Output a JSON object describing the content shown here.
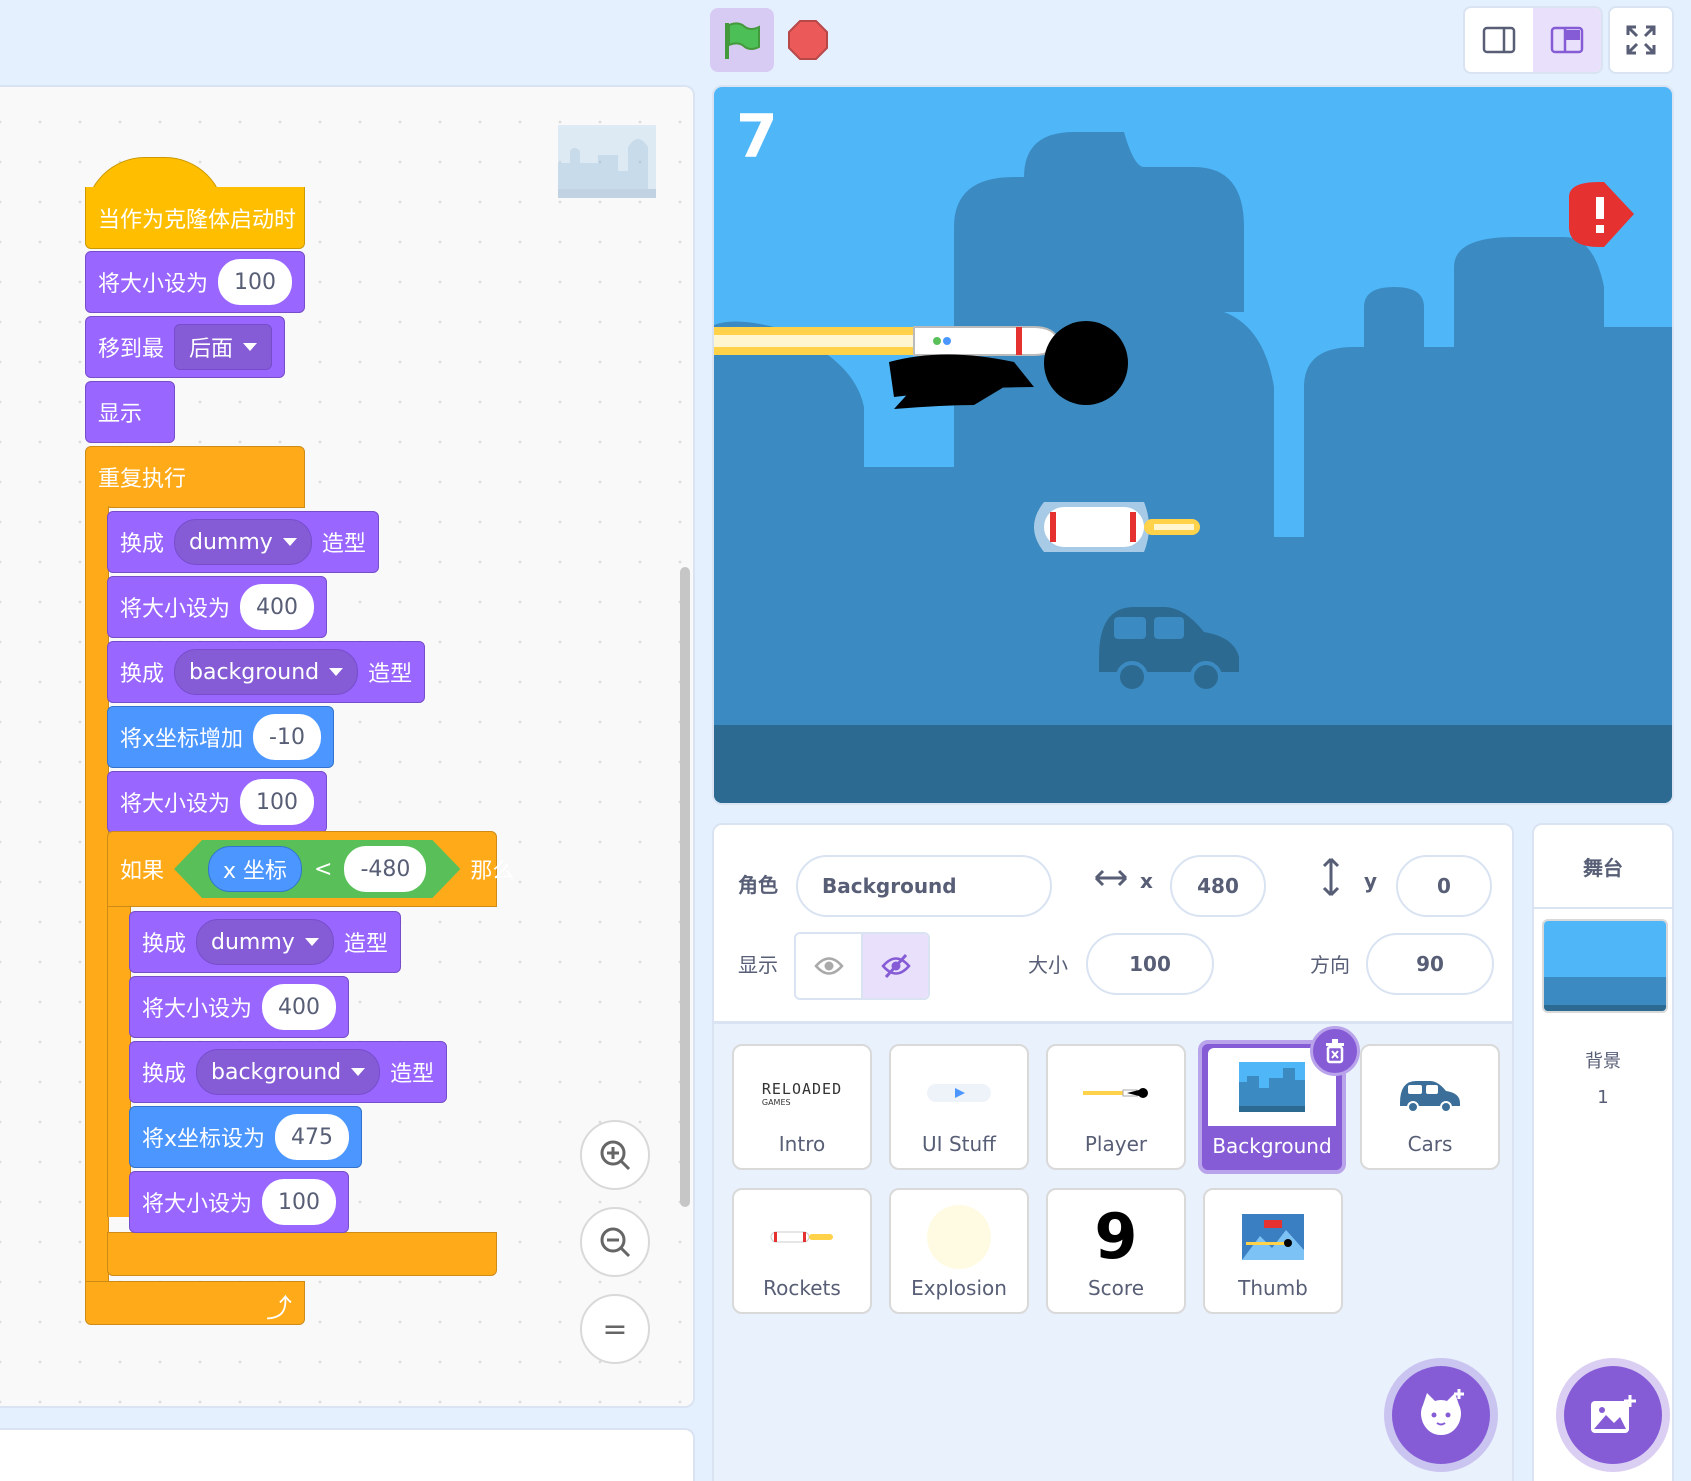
{
  "code_blocks": {
    "hat": "当作为克隆体启动时",
    "set_size_1": {
      "label": "将大小设为",
      "value": "100"
    },
    "go_to_layer": {
      "label": "移到最",
      "option": "后面"
    },
    "show": "显示",
    "forever": "重复执行",
    "switch_1": {
      "label": "换成",
      "option": "dummy",
      "suffix": "造型"
    },
    "set_size_2": {
      "label": "将大小设为",
      "value": "400"
    },
    "switch_2": {
      "label": "换成",
      "option": "background",
      "suffix": "造型"
    },
    "change_x": {
      "label": "将x坐标增加",
      "value": "-10"
    },
    "set_size_3": {
      "label": "将大小设为",
      "value": "100"
    },
    "if_block": {
      "label": "如果",
      "reporter": "x 坐标",
      "operator": "<",
      "value": "-480",
      "then": "那么"
    },
    "switch_3": {
      "label": "换成",
      "option": "dummy",
      "suffix": "造型"
    },
    "set_size_4": {
      "label": "将大小设为",
      "value": "400"
    },
    "switch_4": {
      "label": "换成",
      "option": "background",
      "suffix": "造型"
    },
    "set_x": {
      "label": "将x坐标设为",
      "value": "475"
    },
    "set_size_5": {
      "label": "将大小设为",
      "value": "100"
    }
  },
  "zoom": {
    "in": "+",
    "out": "−",
    "reset": "="
  },
  "stage": {
    "score": "7"
  },
  "sprite_info": {
    "sprite_label": "角色",
    "sprite_name": "Background",
    "x_label": "x",
    "x_value": "480",
    "y_label": "y",
    "y_value": "0",
    "show_label": "显示",
    "size_label": "大小",
    "size_value": "100",
    "direction_label": "方向",
    "direction_value": "90"
  },
  "sprites": [
    {
      "name": "Intro",
      "logo": "RELOADED",
      "logo_sub": "GAMES"
    },
    {
      "name": "UI Stuff"
    },
    {
      "name": "Player"
    },
    {
      "name": "Background",
      "selected": true
    },
    {
      "name": "Cars"
    },
    {
      "name": "Rockets"
    },
    {
      "name": "Explosion"
    },
    {
      "name": "Score",
      "glyph": "9"
    },
    {
      "name": "Thumb"
    }
  ],
  "stage_panel": {
    "title": "舞台",
    "backdrops_label": "背景",
    "backdrops_count": "1"
  },
  "colors": {
    "looks": "#9966ff",
    "motion": "#4c97ff",
    "control": "#ffab19",
    "event": "#ffbf00",
    "operator": "#59c059",
    "sky": "#4fb6f8",
    "city": "#3b8bc2",
    "ground": "#2d6a91"
  }
}
